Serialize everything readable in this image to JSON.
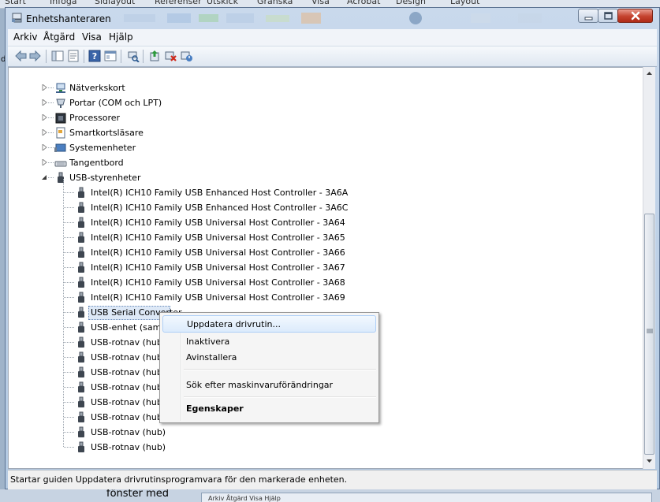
{
  "background_ribbon": {
    "tabs": [
      "Start",
      "Infoga",
      "Sidlayout",
      "Referenser",
      "Utskick",
      "Granska",
      "Visa",
      "Acrobat",
      "Design",
      "Layout"
    ]
  },
  "left_edge_char": "d",
  "window": {
    "title": "Enhetshanteraren",
    "menu": [
      "Arkiv",
      "Åtgärd",
      "Visa",
      "Hjälp"
    ],
    "toolbar_icons": [
      "back-icon",
      "forward-icon",
      "show-hide-tree-icon",
      "properties-icon",
      "help-icon",
      "view-icon",
      "scan-hardware-icon",
      "update-driver-icon",
      "uninstall-icon",
      "disable-icon"
    ]
  },
  "tree": {
    "categories": [
      {
        "label": "Nätverkskort",
        "icon": "network-adapter-icon"
      },
      {
        "label": "Portar (COM och LPT)",
        "icon": "port-icon"
      },
      {
        "label": "Processorer",
        "icon": "processor-icon"
      },
      {
        "label": "Smartkortsläsare",
        "icon": "smartcard-reader-icon"
      },
      {
        "label": "Systemenheter",
        "icon": "system-devices-icon"
      },
      {
        "label": "Tangentbord",
        "icon": "keyboard-icon"
      },
      {
        "label": "USB-styrenheter",
        "icon": "usb-icon",
        "expanded": true
      }
    ],
    "usb_children": [
      "Intel(R) ICH10 Family USB Enhanced Host Controller - 3A6A",
      "Intel(R) ICH10 Family USB Enhanced Host Controller - 3A6C",
      "Intel(R) ICH10 Family USB Universal Host Controller - 3A64",
      "Intel(R) ICH10 Family USB Universal Host Controller - 3A65",
      "Intel(R) ICH10 Family USB Universal Host Controller - 3A66",
      "Intel(R) ICH10 Family USB Universal Host Controller - 3A67",
      "Intel(R) ICH10 Family USB Universal Host Controller - 3A68",
      "Intel(R) ICH10 Family USB Universal Host Controller - 3A69",
      "USB Serial Converter",
      "USB-enhet (samr",
      "USB-rotnav (hub)",
      "USB-rotnav (hub)",
      "USB-rotnav (hub)",
      "USB-rotnav (hub)",
      "USB-rotnav (hub)",
      "USB-rotnav (hub)",
      "USB-rotnav (hub)",
      "USB-rotnav (hub)"
    ],
    "selected_item": "USB Serial Converter"
  },
  "context_menu": {
    "update": "Uppdatera drivrutin...",
    "disable": "Inaktivera",
    "uninstall": "Avinstallera",
    "scan": "Sök efter maskinvaruförändringar",
    "properties": "Egenskaper"
  },
  "status_bar": "Startar guiden Uppdatera drivrutinsprogramvara för den markerade enheten.",
  "below_window": {
    "text": "fönster med",
    "menu": "Arkiv   Åtgärd   Visa   Hjälp"
  }
}
